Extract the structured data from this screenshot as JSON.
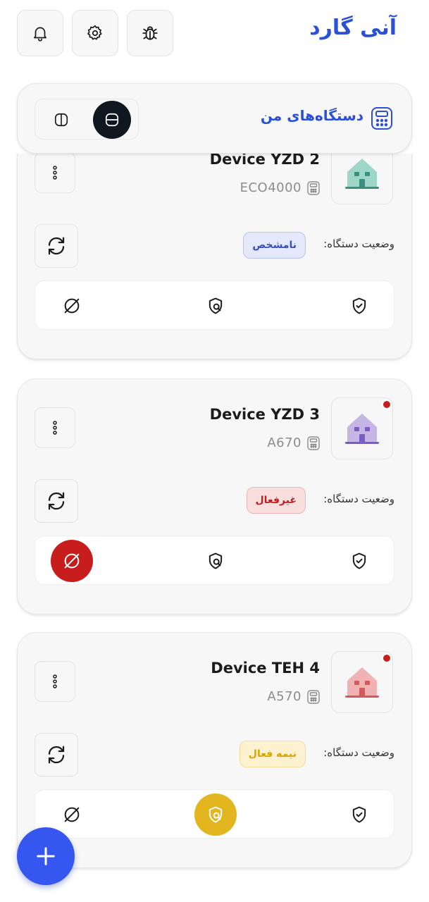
{
  "app": {
    "logo_text": "آنی گارد"
  },
  "topbar": {
    "buttons": [
      {
        "icon": "bell-icon"
      },
      {
        "icon": "gear-icon"
      },
      {
        "icon": "bug-icon"
      }
    ]
  },
  "section": {
    "title": "دستگاه‌های من",
    "icon": "device-icon"
  },
  "status_label": "وضعیت دستگاه:",
  "devices": [
    {
      "name": "Device YZD 2",
      "model": "ECO4000",
      "status": "نامشخص",
      "house_color": "#9ed6c8",
      "alert": false,
      "active_action": null
    },
    {
      "name": "Device YZD 3",
      "model": "A670",
      "status": "غیرفعال",
      "house_color": "#c6b6e6",
      "alert": true,
      "active_action": "disarm"
    },
    {
      "name": "Device TEH 4",
      "model": "A570",
      "status": "نیمه فعال",
      "house_color": "#f0b2b2",
      "alert": true,
      "active_action": "partial"
    }
  ],
  "colors": {
    "accent": "#2a4fd8",
    "status_unknown_bg": "#e4e8fb",
    "status_unknown_fg": "#3a4cc0",
    "status_inactive_bg": "#f9dede",
    "status_inactive_fg": "#c21c1c",
    "status_partial_bg": "#fdf2cf",
    "status_partial_fg": "#d9a400",
    "disarm_active": "#c81d1d",
    "partial_active": "#e3b51e",
    "fab": "#3557f0"
  }
}
